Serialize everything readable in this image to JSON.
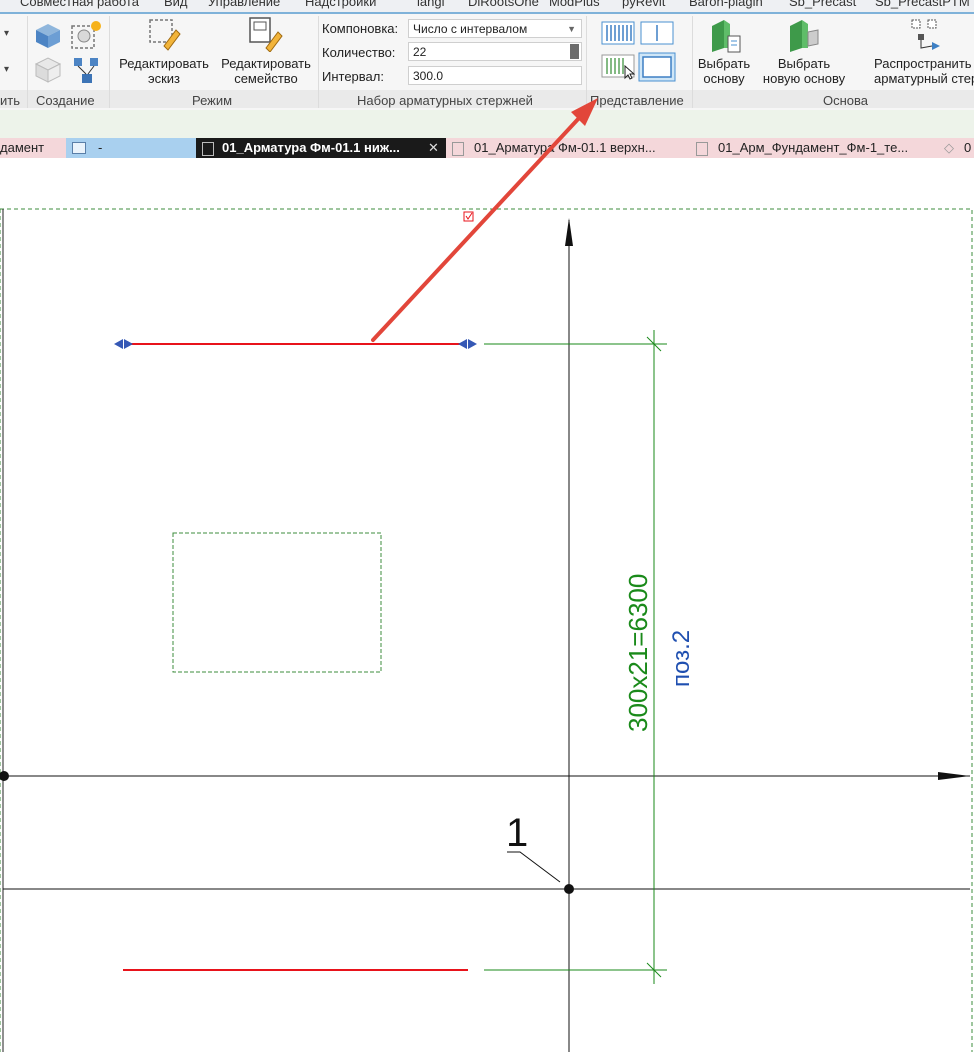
{
  "menu": [
    "Совместная работа",
    "Вид",
    "Управление",
    "Надстройки",
    "langi",
    "DiRootsOne",
    "ModPlus",
    "pyRevit",
    "Baron-plagin",
    "Sb_Precast",
    "Sb_PrecastPTM"
  ],
  "ribbon": {
    "groups": {
      "cut_left": "ить",
      "create": "Создание",
      "mode": "Режим",
      "rebar_set": "Набор арматурных стержней",
      "presentation": "Представление",
      "host": "Основа"
    },
    "buttons": {
      "edit_sketch": [
        "Редактировать",
        "эскиз"
      ],
      "edit_family": [
        "Редактировать",
        "семейство"
      ],
      "pick_host": [
        "Выбрать",
        "основу"
      ],
      "pick_new_host": [
        "Выбрать",
        "новую основу"
      ],
      "distribute": [
        "Распространить",
        "арматурный стерж"
      ]
    },
    "layout": {
      "label": "Компоновка:",
      "value": "Число с интервалом"
    },
    "quantity": {
      "label": "Количество:",
      "value": "22"
    },
    "spacing": {
      "label": "Интервал:",
      "value": "300.0"
    }
  },
  "tabs": [
    {
      "label": "дамент",
      "active": false
    },
    {
      "label": "-",
      "active": false
    },
    {
      "label": "01_Арматура Фм-01.1 ниж...",
      "active": true
    },
    {
      "label": "01_Арматура Фм-01.1 верхн...",
      "active": false
    },
    {
      "label": "01_Арм_Фундамент_Фм-1_те...",
      "active": false
    },
    {
      "label": "0",
      "active": false
    }
  ],
  "drawing": {
    "dimension_text": "300x21=6300",
    "tag_text": "поз.2",
    "grid_label": "1"
  },
  "colors": {
    "rebar": "#e8131b",
    "dimension": "#1a8a1a",
    "tag": "#1f4fb0",
    "annotation_arrow": "#e2463a",
    "active_tab_bg": "#1a1a1a",
    "tabbar_bg": "#f4d7da"
  }
}
